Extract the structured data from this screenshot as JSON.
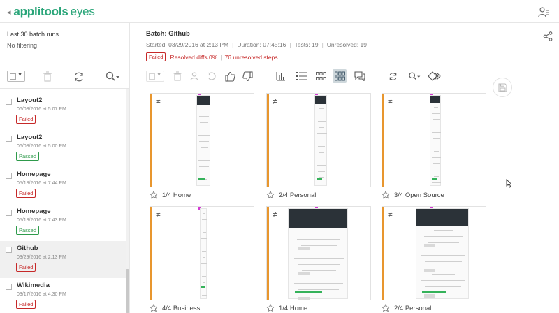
{
  "app": {
    "brand": "applitools",
    "product": "eyes"
  },
  "sidebar": {
    "title": "Last 30 batch runs",
    "filter": "No filtering",
    "runs": [
      {
        "name": "Layout2",
        "date": "06/08/2016 at 5:07 PM",
        "status": "Failed"
      },
      {
        "name": "Layout2",
        "date": "06/08/2016 at 5:00 PM",
        "status": "Passed"
      },
      {
        "name": "Homepage",
        "date": "05/18/2016 at 7:44 PM",
        "status": "Failed"
      },
      {
        "name": "Homepage",
        "date": "05/18/2016 at 7:43 PM",
        "status": "Passed"
      },
      {
        "name": "Github",
        "date": "03/29/2016 at 2:13 PM",
        "status": "Failed",
        "selected": true
      },
      {
        "name": "Wikimedia",
        "date": "03/17/2016 at 4:30 PM",
        "status": "Failed"
      }
    ]
  },
  "batch": {
    "title": "Batch: Github",
    "started": "Started: 03/29/2016 at 2:13 PM",
    "duration": "Duration: 07:45:16",
    "tests": "Tests: 19",
    "unresolved": "Unresolved: 19",
    "status": "Failed",
    "resolved_diffs": "Resolved diffs 0%",
    "unresolved_steps": "76 unresolved steps"
  },
  "grid": {
    "mismatch_symbol": "≠",
    "items": [
      {
        "label": "1/4 Home"
      },
      {
        "label": "2/4 Personal"
      },
      {
        "label": "3/4 Open Source"
      },
      {
        "label": "4/4 Business"
      },
      {
        "label": "1/4 Home"
      },
      {
        "label": "2/4 Personal"
      }
    ]
  },
  "colors": {
    "brand_green": "#2aa579",
    "failed_red": "#c62828",
    "passed_green": "#2e9a4b",
    "diff_orange": "#e8962e",
    "active_view_bg": "#cfd8dc"
  }
}
